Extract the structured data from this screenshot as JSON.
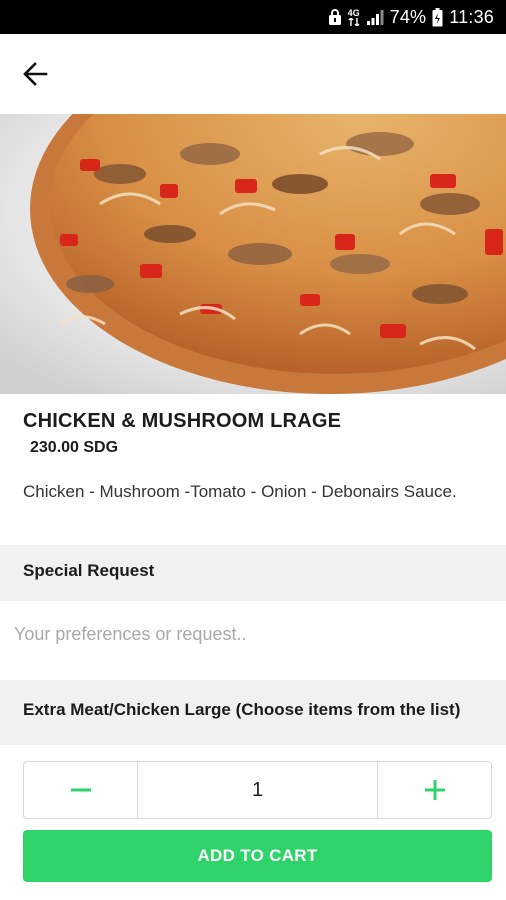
{
  "status_bar": {
    "network_label": "4G",
    "battery_percent": "74%",
    "time": "11:36",
    "icons": [
      "lock-icon",
      "network-icon",
      "signal-icon",
      "battery-icon"
    ]
  },
  "app_bar": {
    "back_icon": "arrow-left-icon"
  },
  "product": {
    "image_subject": "pizza",
    "title": "CHICKEN & MUSHROOM LRAGE",
    "price": "230.00 SDG",
    "description": "Chicken - Mushroom -Tomato - Onion - Debonairs Sauce."
  },
  "special_request": {
    "header": "Special Request",
    "placeholder": "Your preferences or request..",
    "value": ""
  },
  "extras": {
    "header": "Extra Meat/Chicken Large (Choose items from the list)"
  },
  "quantity": {
    "value": "1",
    "minus_icon": "minus-icon",
    "plus_icon": "plus-icon"
  },
  "add_to_cart_label": "ADD TO CART",
  "colors": {
    "accent": "#2ed36a",
    "status_bar": "#000000",
    "section_bg": "#f1f1f1"
  }
}
